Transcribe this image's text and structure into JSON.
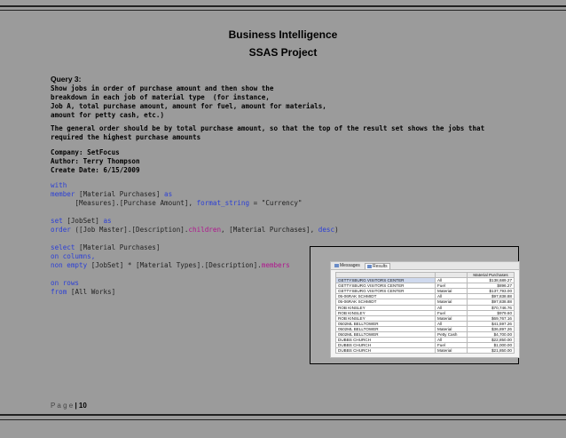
{
  "header": {
    "title": "Business Intelligence",
    "subtitle": "SSAS Project"
  },
  "query": {
    "title": "Query 3:",
    "description": [
      "Show jobs in order of purchase amount and then show the",
      "breakdown in each job of material type  (for instance,",
      "Job A, total purchase amount, amount for fuel, amount for materials,",
      "amount for petty cash, etc.)"
    ],
    "general_order": [
      "The general order should be by total purchase amount, so that the top of the result set shows the jobs that",
      "required the highest purchase amounts"
    ],
    "company": "Company: SetFocus",
    "author": "Author: Terry Thompson",
    "create_date": "Create Date: 6/15/2009"
  },
  "code": {
    "l1": "with",
    "l2_kw": "member",
    "l2_rest": " [Material Purchases] ",
    "l2_as": "as",
    "l3": "      [Measures].[Purchase Amount], ",
    "l3_fmt": "format_string",
    "l3_val": " = \"Currency\"",
    "l4_kw": "set",
    "l4_rest": " [JobSet] ",
    "l4_as": "as",
    "l5_kw": "order",
    "l5_a": " ([Job Master].[Description].",
    "l5_fn": "children",
    "l5_b": ", [Material Purchases], ",
    "l5_desc": "desc",
    "l5_c": ")",
    "l6_kw": "select",
    "l6_rest": " [Material Purchases]",
    "l7": "on columns,",
    "l8_kw": "non empty",
    "l8_rest": " [JobSet] * [Material Types].[Description].",
    "l8_fn": "members",
    "l9": "on rows",
    "l10_kw": "from",
    "l10_rest": " [All Works]"
  },
  "results": {
    "tab_messages": "Messages",
    "tab_results": "Results",
    "column_header": "Material Purchases",
    "rows": [
      [
        "GETTYSBURG VISITORS CENTER",
        "All",
        "$138,689.27"
      ],
      [
        "GETTYSBURG VISITORS CENTER",
        "Fuel",
        "$896.27"
      ],
      [
        "GETTYSBURG VISITORS CENTER",
        "Material",
        "$137,793.00"
      ],
      [
        "05-06RAK SCHMIDT",
        "All",
        "$97,838.88"
      ],
      [
        "05-06RAK SCHMIDT",
        "Material",
        "$97,838.88"
      ],
      [
        "ROB KINSLEY",
        "All",
        "$70,746.76"
      ],
      [
        "ROB KINSLEY",
        "Fuel",
        "$979.60"
      ],
      [
        "ROB KINSLEY",
        "Material",
        "$69,767.16"
      ],
      [
        "0502ML BELLTOWER",
        "All",
        "$41,597.26"
      ],
      [
        "0502ML BELLTOWER",
        "Material",
        "$36,897.26"
      ],
      [
        "0502ML BELLTOWER",
        "Petty Cash",
        "$4,700.00"
      ],
      [
        "DUBBS CHURCH",
        "All",
        "$22,850.00"
      ],
      [
        "DUBBS CHURCH",
        "Fuel",
        "$1,000.00"
      ],
      [
        "DUBBS CHURCH",
        "Material",
        "$21,850.00"
      ]
    ]
  },
  "footer": {
    "page_label": "P a g e",
    "page_number": "| 10"
  }
}
